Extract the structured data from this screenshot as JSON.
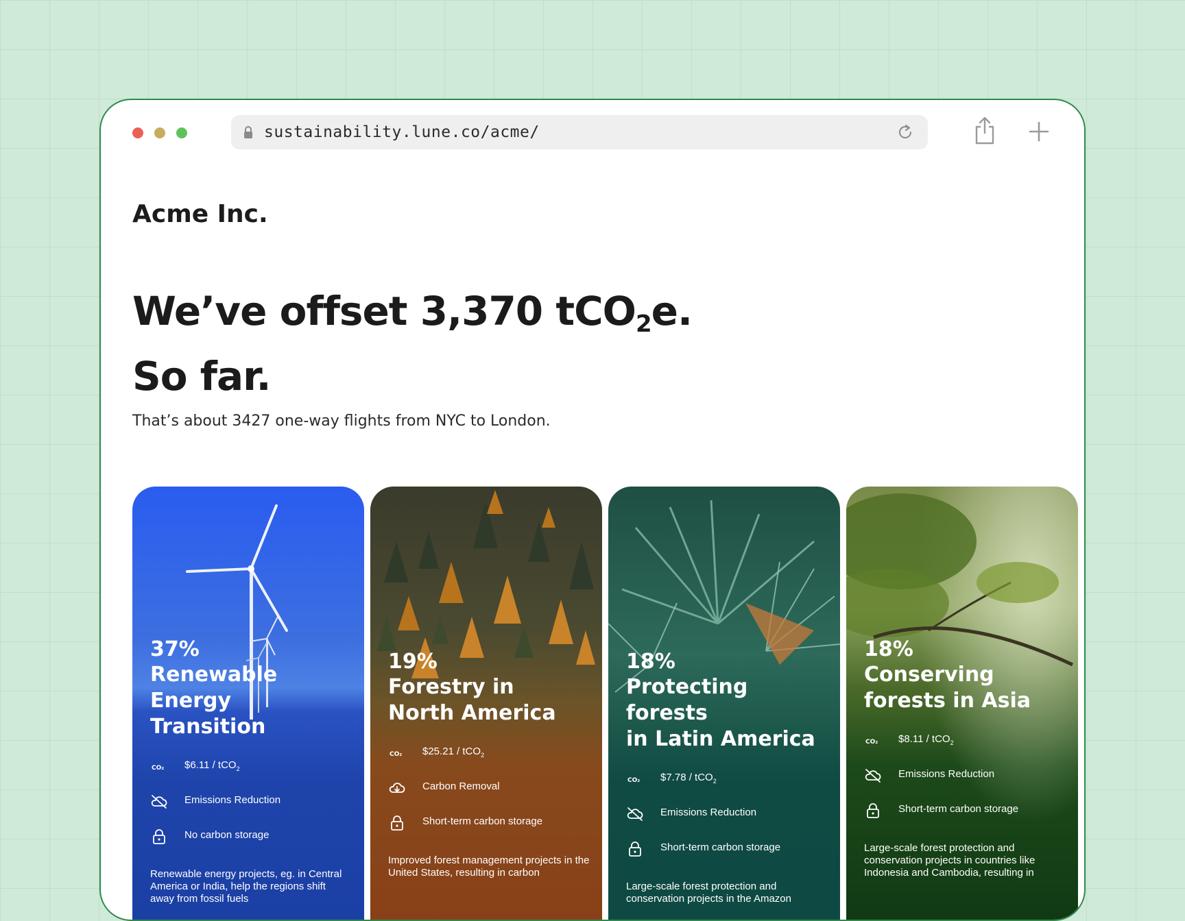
{
  "browser": {
    "url": "sustainability.lune.co/acme/"
  },
  "page": {
    "org_name": "Acme Inc.",
    "headline_prefix": "We’ve offset 3,370 tCO",
    "headline_sub": "2",
    "headline_suffix": "e.",
    "headline_line2": "So far.",
    "subline": "That’s about 3427 one-way flights from NYC to London."
  },
  "cards": [
    {
      "percent": "37%",
      "title_line1": "Renewable Energy",
      "title_line2": "Transition",
      "price": "$6.11 / tCO",
      "price_sub": "2",
      "type": "Emissions Reduction",
      "storage": "No carbon storage",
      "description": "Renewable energy projects, eg. in Central America or India, help the regions shift away from fossil fuels",
      "icons": [
        "co2-icon",
        "cloud-slash-icon",
        "lock-icon"
      ],
      "color": "#1b40a8"
    },
    {
      "percent": "19%",
      "title_line1": "Forestry in",
      "title_line2": "North America",
      "price": "$25.21 / tCO",
      "price_sub": "2",
      "type": "Carbon Removal",
      "storage": "Short-term carbon storage",
      "description": "Improved forest management projects in the United States, resulting in carbon",
      "icons": [
        "co2-icon",
        "cloud-download-icon",
        "lock-icon"
      ],
      "color": "#8a3d16"
    },
    {
      "percent": "18%",
      "title_line1": "Protecting forests",
      "title_line2": "in Latin America",
      "price": "$7.78 / tCO",
      "price_sub": "2",
      "type": "Emissions Reduction",
      "storage": "Short-term carbon storage",
      "description": "Large-scale forest protection and conservation projects in the Amazon",
      "icons": [
        "co2-icon",
        "cloud-slash-icon",
        "lock-icon"
      ],
      "color": "#0e4a43"
    },
    {
      "percent": "18%",
      "title_line1": "Conserving",
      "title_line2": "forests in Asia",
      "price": "$8.11 / tCO",
      "price_sub": "2",
      "type": "Emissions Reduction",
      "storage": "Short-term carbon storage",
      "description": "Large-scale forest protection and conservation projects in countries like Indonesia and Cambodia, resulting in",
      "icons": [
        "co2-icon",
        "cloud-slash-icon",
        "lock-icon"
      ],
      "color": "#0d3512"
    }
  ]
}
